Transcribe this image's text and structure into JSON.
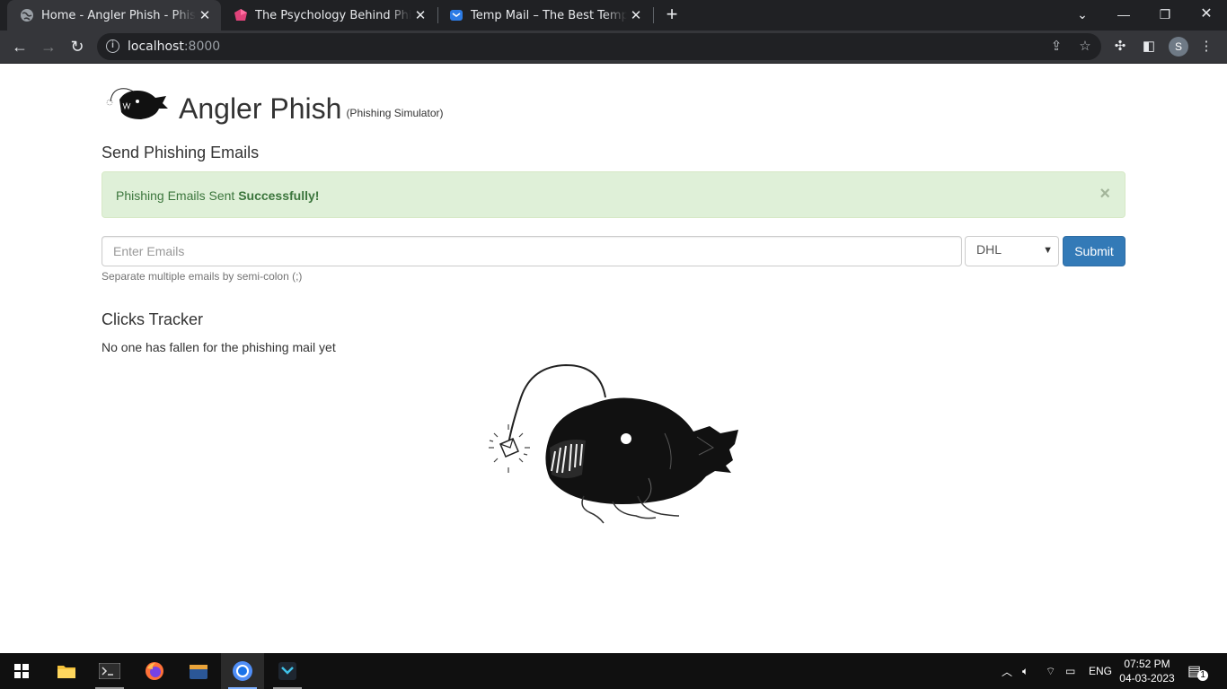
{
  "browser": {
    "tabs": [
      {
        "title": "Home - Angler Phish - Phishing Simulator",
        "active": true
      },
      {
        "title": "The Psychology Behind Phishing",
        "active": false
      },
      {
        "title": "Temp Mail – The Best Temp Email",
        "active": false
      }
    ],
    "url_host": "localhost",
    "url_port": ":8000",
    "profile_initial": "S"
  },
  "page": {
    "brand_name": "Angler Phish",
    "brand_sub": "(Phishing Simulator)",
    "send_heading": "Send Phishing Emails",
    "alert_text": "Phishing Emails Sent ",
    "alert_strong": "Successfully!",
    "alert_close": "×",
    "email_placeholder": "Enter Emails",
    "template_selected": "DHL",
    "submit_label": "Submit",
    "help_text": "Separate multiple emails by semi-colon (;)",
    "clicks_heading": "Clicks Tracker",
    "no_clicks_text": "No one has fallen for the phishing mail yet"
  },
  "taskbar": {
    "language": "ENG",
    "time": "07:52 PM",
    "date": "04-03-2023",
    "notifications": "1"
  },
  "colors": {
    "alert_bg": "#dff0d8",
    "alert_text": "#3c763d",
    "primary": "#337ab7"
  }
}
